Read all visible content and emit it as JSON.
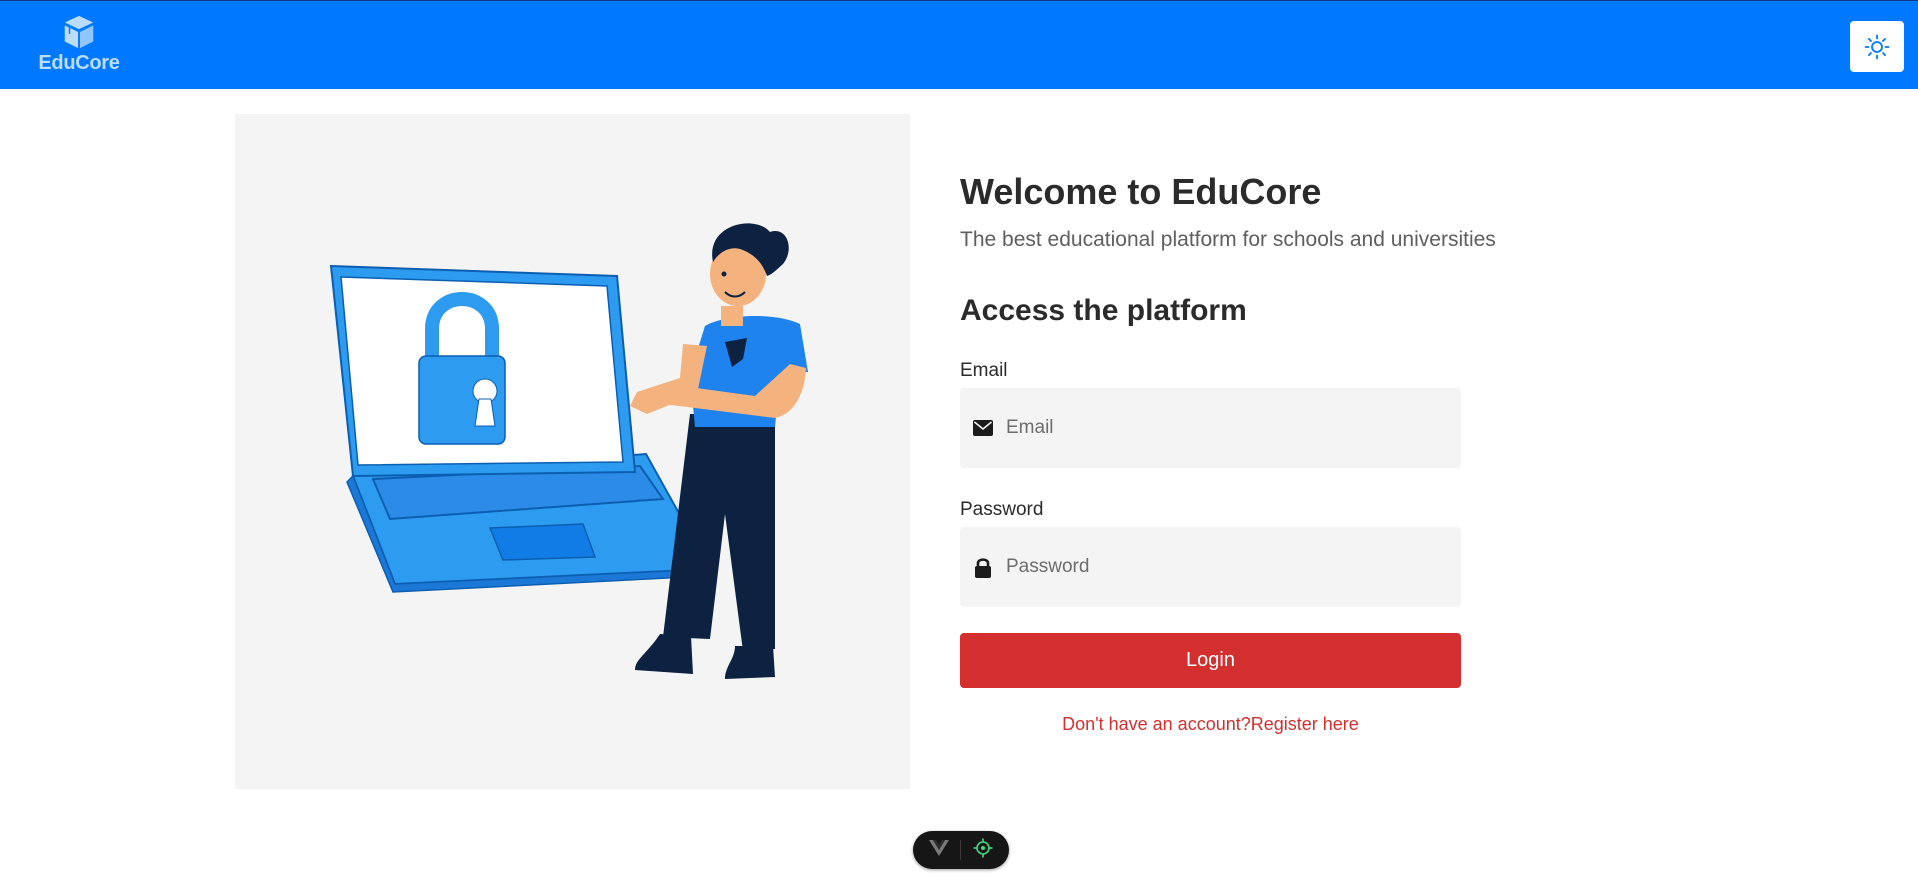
{
  "header": {
    "logo_text": "EduCore",
    "logo_icon": "cube-box-icon",
    "theme_toggle_icon": "sun-icon"
  },
  "illustration": {
    "icon": "person-laptop-lock-illustration"
  },
  "main": {
    "welcome_title": "Welcome to EduCore",
    "welcome_subtitle": "The best educational platform for schools and universities",
    "access_title": "Access the platform"
  },
  "form": {
    "email_label": "Email",
    "email_placeholder": "Email",
    "email_value": "",
    "email_icon": "envelope-icon",
    "password_label": "Password",
    "password_placeholder": "Password",
    "password_value": "",
    "password_icon": "lock-icon",
    "login_label": "Login",
    "register_prompt": "Don't have an account?",
    "register_link": "Register here"
  },
  "devtools": {
    "left_icon": "vue-logo-icon",
    "right_icon": "crosshair-icon"
  },
  "colors": {
    "header_bg": "#0078ff",
    "login_button": "#d32f2f",
    "register_text": "#d32f2f",
    "input_bg": "#f4f4f4",
    "illustration_bg": "#f4f4f4"
  }
}
